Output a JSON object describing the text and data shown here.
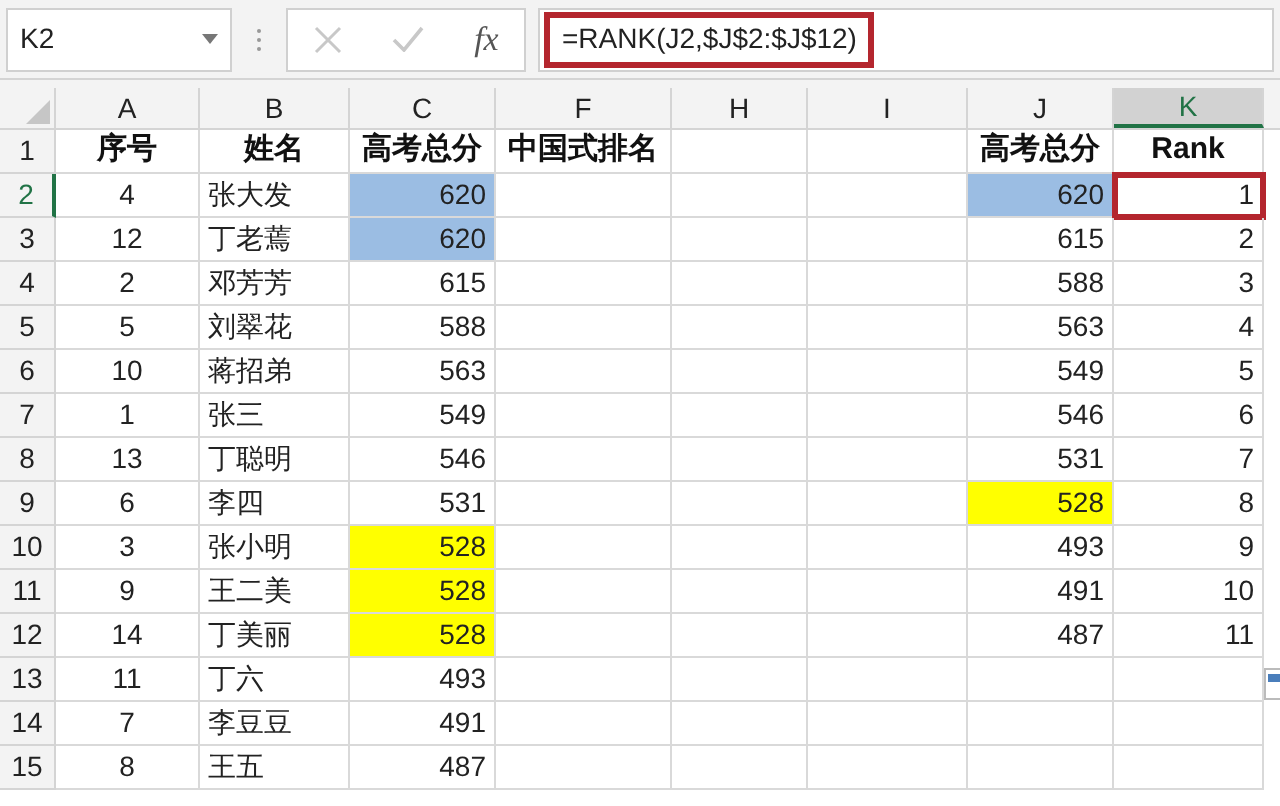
{
  "formula_bar": {
    "name_box": "K2",
    "fx": "fx",
    "formula": "=RANK(J2,$J$2:$J$12)",
    "outlined": true
  },
  "columns": [
    {
      "letter": "A",
      "kind": "center"
    },
    {
      "letter": "B",
      "kind": "left"
    },
    {
      "letter": "C",
      "kind": "right"
    },
    {
      "letter": "F",
      "kind": "left"
    },
    {
      "letter": "H",
      "kind": "left"
    },
    {
      "letter": "I",
      "kind": "left"
    },
    {
      "letter": "J",
      "kind": "right"
    },
    {
      "letter": "K",
      "kind": "right"
    }
  ],
  "rows": [
    {
      "number": "1",
      "kind": "header",
      "cells": [
        {
          "text": "序号",
          "selected": false
        },
        {
          "text": "姓名",
          "selected": false
        },
        {
          "text": "高考总分",
          "selected": false
        },
        {
          "text": "中国式排名",
          "selected": false
        },
        {
          "selected": false
        },
        {
          "selected": false
        },
        {
          "text": "高考总分",
          "selected": false
        },
        {
          "text": "Rank",
          "selected": false
        }
      ]
    },
    {
      "number": "2",
      "kind": "data",
      "cells": [
        {
          "text": "4",
          "selected": false
        },
        {
          "text": "张大发",
          "selected": false
        },
        {
          "text": "620",
          "color": "#9bbde3",
          "selected": false
        },
        {
          "selected": false
        },
        {
          "selected": false
        },
        {
          "selected": false
        },
        {
          "text": "620",
          "color": "#9bbde3",
          "selected": false
        },
        {
          "text": "1",
          "selected": true
        }
      ]
    },
    {
      "number": "3",
      "kind": "data",
      "cells": [
        {
          "text": "12",
          "selected": false
        },
        {
          "text": "丁老蔫",
          "selected": false
        },
        {
          "text": "620",
          "color": "#9bbde3",
          "selected": false
        },
        {
          "selected": false
        },
        {
          "selected": false
        },
        {
          "selected": false
        },
        {
          "text": "615",
          "selected": false
        },
        {
          "text": "2",
          "selected": false
        }
      ]
    },
    {
      "number": "4",
      "kind": "data",
      "cells": [
        {
          "text": "2",
          "selected": false
        },
        {
          "text": "邓芳芳",
          "selected": false
        },
        {
          "text": "615",
          "selected": false
        },
        {
          "selected": false
        },
        {
          "selected": false
        },
        {
          "selected": false
        },
        {
          "text": "588",
          "selected": false
        },
        {
          "text": "3",
          "selected": false
        }
      ]
    },
    {
      "number": "5",
      "kind": "data",
      "cells": [
        {
          "text": "5",
          "selected": false
        },
        {
          "text": "刘翠花",
          "selected": false
        },
        {
          "text": "588",
          "selected": false
        },
        {
          "selected": false
        },
        {
          "selected": false
        },
        {
          "selected": false
        },
        {
          "text": "563",
          "selected": false
        },
        {
          "text": "4",
          "selected": false
        }
      ]
    },
    {
      "number": "6",
      "kind": "data",
      "cells": [
        {
          "text": "10",
          "selected": false
        },
        {
          "text": "蒋招弟",
          "selected": false
        },
        {
          "text": "563",
          "selected": false
        },
        {
          "selected": false
        },
        {
          "selected": false
        },
        {
          "selected": false
        },
        {
          "text": "549",
          "selected": false
        },
        {
          "text": "5",
          "selected": false
        }
      ]
    },
    {
      "number": "7",
      "kind": "data",
      "cells": [
        {
          "text": "1",
          "selected": false
        },
        {
          "text": "张三",
          "selected": false
        },
        {
          "text": "549",
          "selected": false
        },
        {
          "selected": false
        },
        {
          "selected": false
        },
        {
          "selected": false
        },
        {
          "text": "546",
          "selected": false
        },
        {
          "text": "6",
          "selected": false
        }
      ]
    },
    {
      "number": "8",
      "kind": "data",
      "cells": [
        {
          "text": "13",
          "selected": false
        },
        {
          "text": "丁聪明",
          "selected": false
        },
        {
          "text": "546",
          "selected": false
        },
        {
          "selected": false
        },
        {
          "selected": false
        },
        {
          "selected": false
        },
        {
          "text": "531",
          "selected": false
        },
        {
          "text": "7",
          "selected": false
        }
      ]
    },
    {
      "number": "9",
      "kind": "data",
      "cells": [
        {
          "text": "6",
          "selected": false
        },
        {
          "text": "李四",
          "selected": false
        },
        {
          "text": "531",
          "selected": false
        },
        {
          "selected": false
        },
        {
          "selected": false
        },
        {
          "selected": false
        },
        {
          "text": "528",
          "color": "#ffff00",
          "selected": false
        },
        {
          "text": "8",
          "selected": false
        }
      ]
    },
    {
      "number": "10",
      "kind": "data",
      "cells": [
        {
          "text": "3",
          "selected": false
        },
        {
          "text": "张小明",
          "selected": false
        },
        {
          "text": "528",
          "color": "#ffff00",
          "selected": false
        },
        {
          "selected": false
        },
        {
          "selected": false
        },
        {
          "selected": false
        },
        {
          "text": "493",
          "selected": false
        },
        {
          "text": "9",
          "selected": false
        }
      ]
    },
    {
      "number": "11",
      "kind": "data",
      "cells": [
        {
          "text": "9",
          "selected": false
        },
        {
          "text": "王二美",
          "selected": false
        },
        {
          "text": "528",
          "color": "#ffff00",
          "selected": false
        },
        {
          "selected": false
        },
        {
          "selected": false
        },
        {
          "selected": false
        },
        {
          "text": "491",
          "selected": false
        },
        {
          "text": "10",
          "selected": false
        }
      ]
    },
    {
      "number": "12",
      "kind": "data",
      "cells": [
        {
          "text": "14",
          "selected": false
        },
        {
          "text": "丁美丽",
          "selected": false
        },
        {
          "text": "528",
          "color": "#ffff00",
          "selected": false
        },
        {
          "selected": false
        },
        {
          "selected": false
        },
        {
          "selected": false
        },
        {
          "text": "487",
          "selected": false
        },
        {
          "text": "11",
          "selected": false
        }
      ]
    },
    {
      "number": "13",
      "kind": "data",
      "cells": [
        {
          "text": "11",
          "selected": false
        },
        {
          "text": "丁六",
          "selected": false
        },
        {
          "text": "493",
          "selected": false
        },
        {
          "selected": false
        },
        {
          "selected": false
        },
        {
          "selected": false
        },
        {
          "selected": false
        },
        {
          "selected": false
        }
      ]
    },
    {
      "number": "14",
      "kind": "data",
      "cells": [
        {
          "text": "7",
          "selected": false
        },
        {
          "text": "李豆豆",
          "selected": false
        },
        {
          "text": "491",
          "selected": false
        },
        {
          "selected": false
        },
        {
          "selected": false
        },
        {
          "selected": false
        },
        {
          "selected": false
        },
        {
          "selected": false
        }
      ]
    },
    {
      "number": "15",
      "kind": "data",
      "cells": [
        {
          "text": "8",
          "selected": false
        },
        {
          "text": "王五",
          "selected": false
        },
        {
          "text": "487",
          "selected": false
        },
        {
          "selected": false
        },
        {
          "selected": false
        },
        {
          "selected": false
        },
        {
          "selected": false
        },
        {
          "selected": false
        }
      ]
    }
  ]
}
